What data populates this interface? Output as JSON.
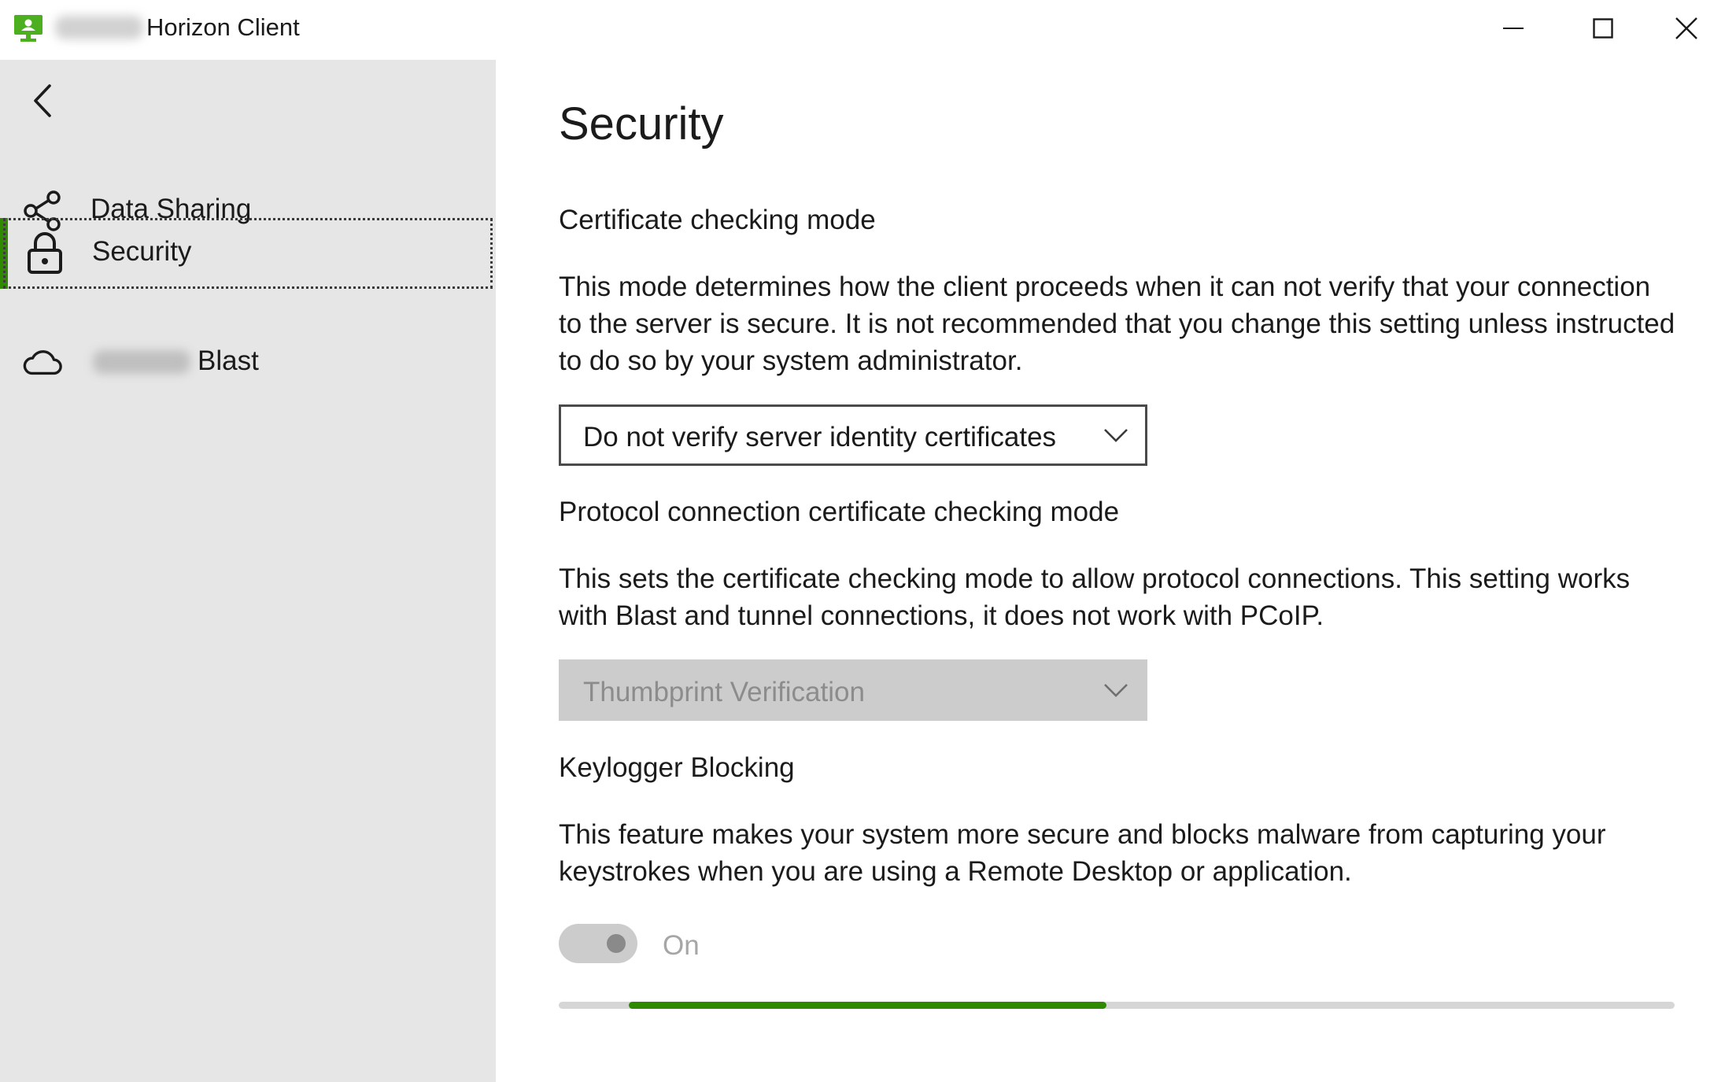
{
  "window": {
    "app_title": "Horizon Client",
    "controls": [
      "minimize-icon",
      "maximize-icon",
      "close-icon"
    ],
    "brand_accent": "#4caf1f"
  },
  "sidebar": {
    "back_icon": "chevron-left-icon",
    "items": [
      {
        "label": "Data Sharing",
        "icon": "share-icon",
        "selected": false
      },
      {
        "label": "Security",
        "icon": "lock-icon",
        "selected": true
      },
      {
        "label": "Blast",
        "icon": "cloud-icon",
        "selected": false
      }
    ],
    "selection_color": "#2f8a00"
  },
  "main": {
    "title": "Security",
    "certificate": {
      "heading": "Certificate checking mode",
      "description": "This mode determines how the client proceeds when it can not verify that your connection to the server is secure. It is not recommended that you change this setting unless instructed to do so by your system administrator.",
      "selected": "Do not verify server identity certificates"
    },
    "protocol": {
      "heading": "Protocol connection certificate checking mode",
      "description": "This sets the certificate checking mode to allow protocol connections. This setting works with Blast and tunnel connections, it does not work with PCoIP.",
      "selected": "Thumbprint Verification",
      "disabled": true
    },
    "keylogger": {
      "heading": "Keylogger Blocking",
      "description": "This feature makes your system more secure and blocks malware from capturing your keystrokes when you are using a Remote Desktop or application.",
      "toggle_state": "On",
      "toggle_on": true,
      "disabled": true
    },
    "progress": {
      "indeterminate": true,
      "segment_start": 0.063,
      "segment_end": 0.491,
      "color": "#2f8a00"
    }
  }
}
